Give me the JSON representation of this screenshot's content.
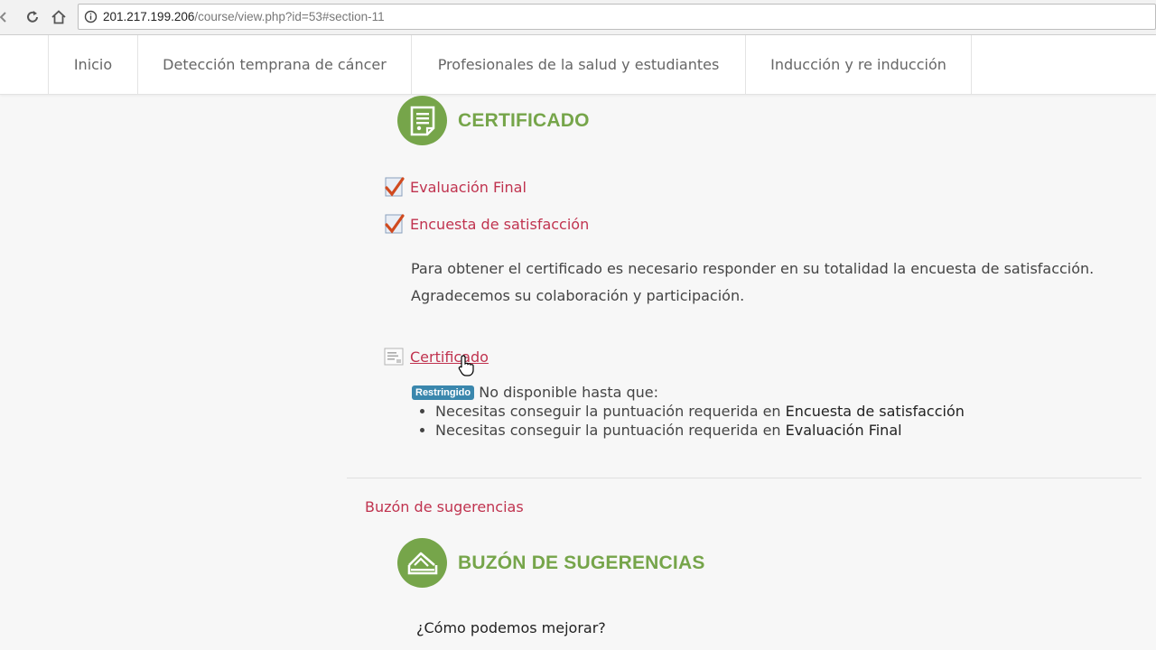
{
  "browser": {
    "url_host": "201.217.199.206",
    "url_path": "/course/view.php?id=53#section-11"
  },
  "topnav": {
    "tabs": [
      {
        "label": "Inicio"
      },
      {
        "label": "Detección temprana de cáncer"
      },
      {
        "label": "Profesionales de la salud y estudiantes"
      },
      {
        "label": "Inducción y re inducción"
      }
    ]
  },
  "certificado_section": {
    "title": "CERTIFICADO",
    "activities": [
      {
        "label": "Evaluación Final",
        "icon": "quiz-check-icon"
      },
      {
        "label": "Encuesta de satisfacción",
        "icon": "survey-check-icon"
      }
    ],
    "description": [
      "Para obtener el certificado es necesario responder en su totalidad la encuesta de satisfacción.",
      "Agradecemos su colaboración y participación."
    ],
    "certificate_activity": {
      "label": "Certificado",
      "icon": "certificate-icon"
    },
    "restriction": {
      "badge": "Restringido",
      "intro": "No disponible hasta que:",
      "conditions": [
        {
          "prefix": "Necesitas conseguir la puntuación requerida en ",
          "target": "Encuesta de satisfacción"
        },
        {
          "prefix": "Necesitas conseguir la puntuación requerida en ",
          "target": "Evaluación Final"
        }
      ]
    }
  },
  "buzon_section": {
    "section_name": "Buzón de sugerencias",
    "title": "BUZÓN DE SUGERENCIAS",
    "question": "¿Cómo podemos mejorar?"
  },
  "colors": {
    "accent_green": "#76a54a",
    "link_red": "#c0334f",
    "badge_blue": "#3a87ad"
  }
}
